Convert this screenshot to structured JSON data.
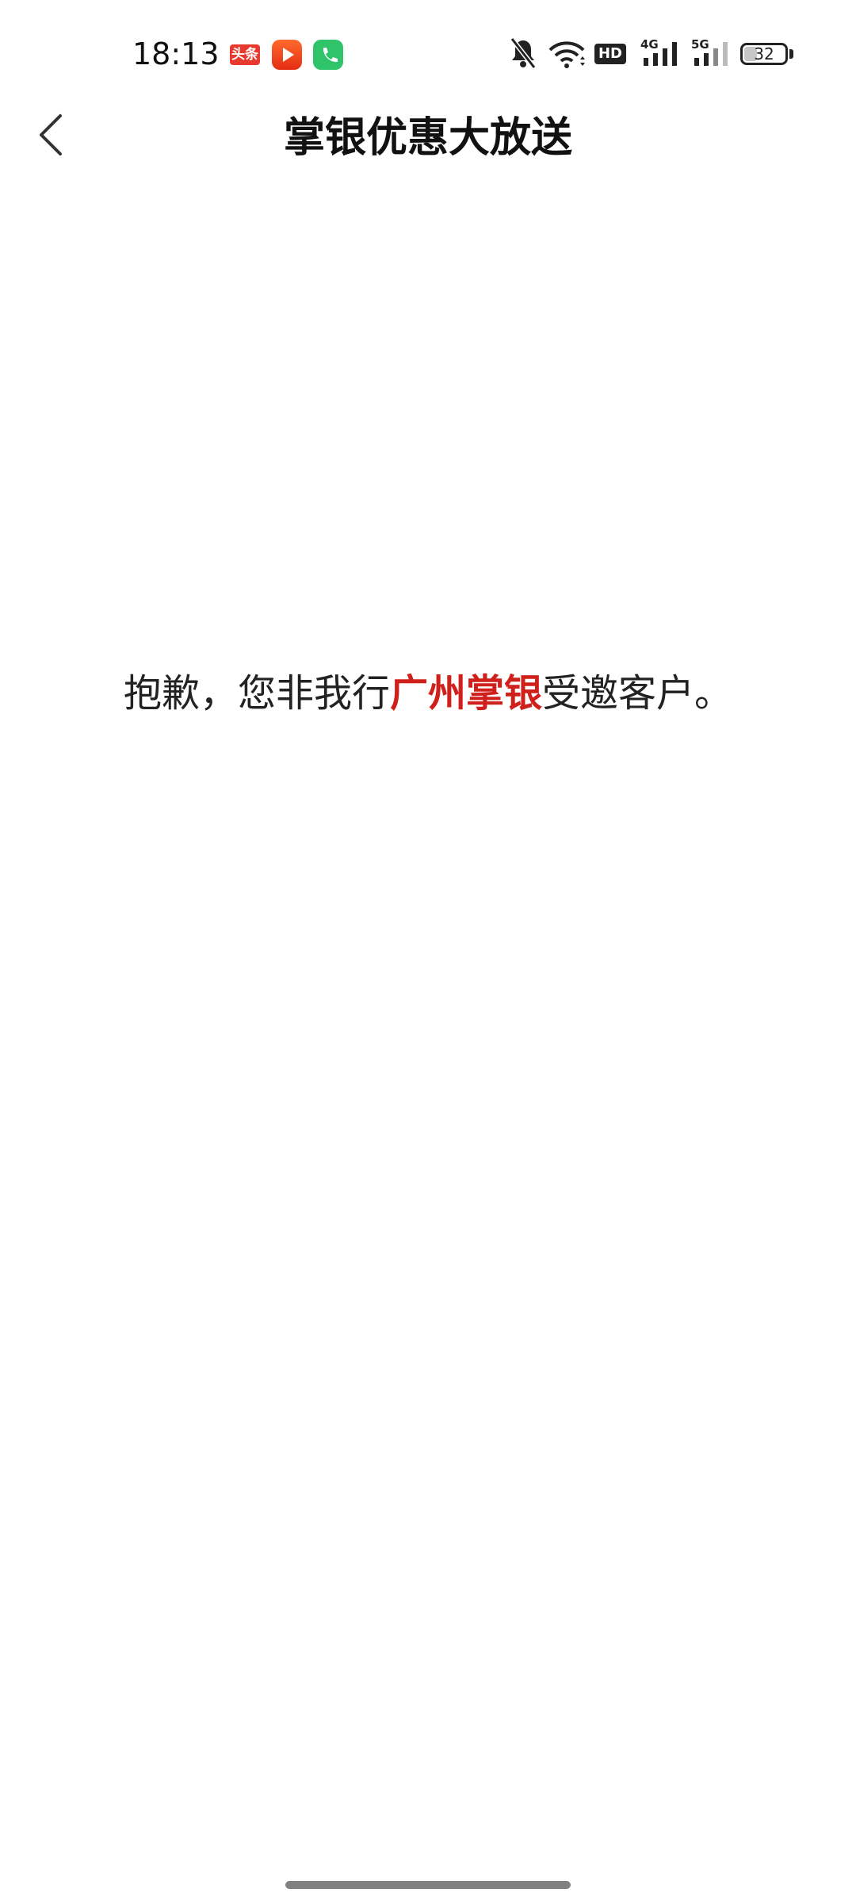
{
  "status_bar": {
    "time": "18:13",
    "apps": [
      {
        "icon": "toutiao-icon",
        "label": "头条"
      },
      {
        "icon": "video-play-icon"
      },
      {
        "icon": "phone-call-icon"
      }
    ],
    "indicators": [
      "bell-muted-icon",
      "wifi-icon",
      "hd-voice-icon",
      "signal-4g-icon",
      "signal-5g-icon"
    ],
    "network_4g": "4G",
    "network_5g": "5G",
    "hd_label": "HD",
    "battery_level": "32",
    "battery_fraction": 0.32
  },
  "header": {
    "title": "掌银优惠大放送",
    "back_icon": "chevron-left-icon"
  },
  "message": {
    "prefix": "抱歉，您非我行",
    "highlight": "广州掌银",
    "suffix": "受邀客户。",
    "highlight_color": "#d0201c"
  }
}
